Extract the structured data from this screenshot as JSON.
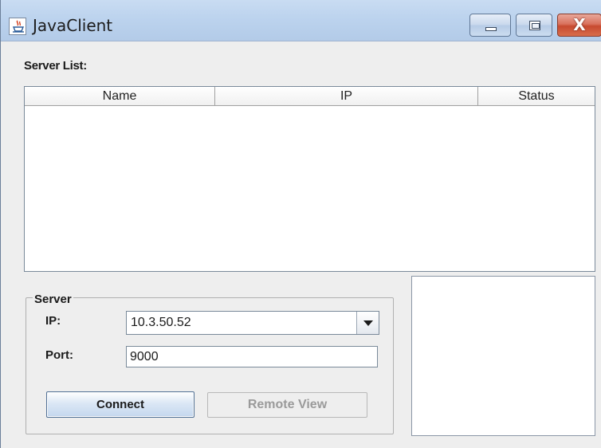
{
  "window": {
    "title": "JavaClient",
    "icon": "java-cup-icon",
    "controls": {
      "minimize_icon": "minimize-icon",
      "maximize_icon": "maximize-icon",
      "close_icon": "close-icon",
      "close_glyph": "X"
    },
    "accent_color": "#c74a30"
  },
  "server_list": {
    "label": "Server List:",
    "columns": [
      "Name",
      "IP",
      "Status"
    ],
    "rows": []
  },
  "server_group": {
    "title": "Server",
    "ip_label": "IP:",
    "ip_value": "10.3.50.52",
    "port_label": "Port:",
    "port_value": "9000",
    "connect_label": "Connect",
    "remote_view_label": "Remote View"
  }
}
